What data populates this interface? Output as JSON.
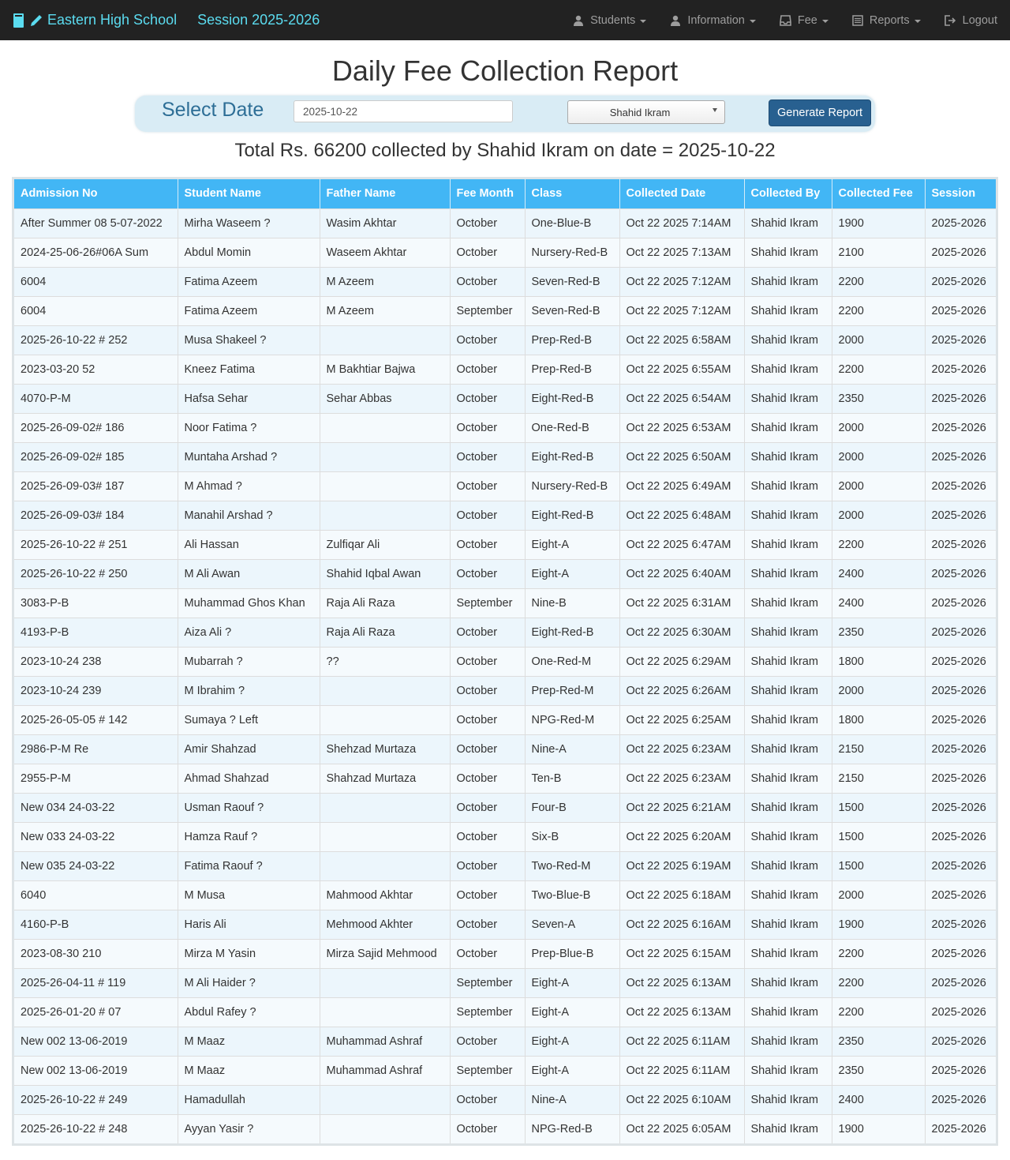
{
  "navbar": {
    "school_name": "Eastern High School",
    "session_label": "Session 2025-2026",
    "menu": [
      {
        "label": "Students",
        "icon": "user-icon",
        "dropdown": true
      },
      {
        "label": "Information",
        "icon": "user-icon",
        "dropdown": true
      },
      {
        "label": "Fee",
        "icon": "inbox-icon",
        "dropdown": true
      },
      {
        "label": "Reports",
        "icon": "list-alt-icon",
        "dropdown": true
      },
      {
        "label": "Logout",
        "icon": "logout-icon",
        "dropdown": false
      }
    ]
  },
  "page_title": "Daily Fee Collection Report",
  "filter": {
    "label": "Select Date",
    "date_value": "2025-10-22",
    "collector_selected": "Shahid Ikram",
    "generate_label": "Generate Report"
  },
  "total_text": "Total Rs. 66200 collected by Shahid Ikram on date = 2025-10-22",
  "colors": {
    "navbar_bg": "#222222",
    "brand": "#5bdcf0",
    "table_header": "#42b6f5",
    "button": "#286090"
  },
  "table": {
    "columns": [
      "Admission No",
      "Student Name",
      "Father Name",
      "Fee Month",
      "Class",
      "Collected Date",
      "Collected By",
      "Collected Fee",
      "Session"
    ],
    "rows": [
      [
        "After Summer 08 5-07-2022",
        "Mirha Waseem ?",
        "Wasim Akhtar",
        "October",
        "One-Blue-B",
        "Oct 22 2025 7:14AM",
        "Shahid Ikram",
        "1900",
        "2025-2026"
      ],
      [
        "2024-25-06-26#06A Sum",
        "Abdul Momin",
        "Waseem Akhtar",
        "October",
        "Nursery-Red-B",
        "Oct 22 2025 7:13AM",
        "Shahid Ikram",
        "2100",
        "2025-2026"
      ],
      [
        "6004",
        "Fatima Azeem",
        "M Azeem",
        "October",
        "Seven-Red-B",
        "Oct 22 2025 7:12AM",
        "Shahid Ikram",
        "2200",
        "2025-2026"
      ],
      [
        "6004",
        "Fatima Azeem",
        "M Azeem",
        "September",
        "Seven-Red-B",
        "Oct 22 2025 7:12AM",
        "Shahid Ikram",
        "2200",
        "2025-2026"
      ],
      [
        "2025-26-10-22 # 252",
        "Musa Shakeel ?",
        "",
        "October",
        "Prep-Red-B",
        "Oct 22 2025 6:58AM",
        "Shahid Ikram",
        "2000",
        "2025-2026"
      ],
      [
        "2023-03-20 52",
        "Kneez Fatima",
        "M Bakhtiar Bajwa",
        "October",
        "Prep-Red-B",
        "Oct 22 2025 6:55AM",
        "Shahid Ikram",
        "2200",
        "2025-2026"
      ],
      [
        "4070-P-M",
        "Hafsa Sehar",
        "Sehar Abbas",
        "October",
        "Eight-Red-B",
        "Oct 22 2025 6:54AM",
        "Shahid Ikram",
        "2350",
        "2025-2026"
      ],
      [
        "2025-26-09-02# 186",
        "Noor Fatima ?",
        "",
        "October",
        "One-Red-B",
        "Oct 22 2025 6:53AM",
        "Shahid Ikram",
        "2000",
        "2025-2026"
      ],
      [
        "2025-26-09-02# 185",
        "Muntaha Arshad ?",
        "",
        "October",
        "Eight-Red-B",
        "Oct 22 2025 6:50AM",
        "Shahid Ikram",
        "2000",
        "2025-2026"
      ],
      [
        "2025-26-09-03# 187",
        "M Ahmad ?",
        "",
        "October",
        "Nursery-Red-B",
        "Oct 22 2025 6:49AM",
        "Shahid Ikram",
        "2000",
        "2025-2026"
      ],
      [
        "2025-26-09-03# 184",
        "Manahil Arshad ?",
        "",
        "October",
        "Eight-Red-B",
        "Oct 22 2025 6:48AM",
        "Shahid Ikram",
        "2000",
        "2025-2026"
      ],
      [
        "2025-26-10-22 # 251",
        "Ali Hassan",
        "Zulfiqar Ali",
        "October",
        "Eight-A",
        "Oct 22 2025 6:47AM",
        "Shahid Ikram",
        "2200",
        "2025-2026"
      ],
      [
        "2025-26-10-22 # 250",
        "M Ali Awan",
        "Shahid Iqbal Awan",
        "October",
        "Eight-A",
        "Oct 22 2025 6:40AM",
        "Shahid Ikram",
        "2400",
        "2025-2026"
      ],
      [
        "3083-P-B",
        "Muhammad Ghos Khan",
        "Raja Ali Raza",
        "September",
        "Nine-B",
        "Oct 22 2025 6:31AM",
        "Shahid Ikram",
        "2400",
        "2025-2026"
      ],
      [
        "4193-P-B",
        "Aiza Ali ?",
        "Raja Ali Raza",
        "October",
        "Eight-Red-B",
        "Oct 22 2025 6:30AM",
        "Shahid Ikram",
        "2350",
        "2025-2026"
      ],
      [
        "2023-10-24 238",
        "Mubarrah ?",
        "??",
        "October",
        "One-Red-M",
        "Oct 22 2025 6:29AM",
        "Shahid Ikram",
        "1800",
        "2025-2026"
      ],
      [
        "2023-10-24 239",
        "M Ibrahim ?",
        "",
        "October",
        "Prep-Red-M",
        "Oct 22 2025 6:26AM",
        "Shahid Ikram",
        "2000",
        "2025-2026"
      ],
      [
        "2025-26-05-05 # 142",
        "Sumaya ? Left",
        "",
        "October",
        "NPG-Red-M",
        "Oct 22 2025 6:25AM",
        "Shahid Ikram",
        "1800",
        "2025-2026"
      ],
      [
        "2986-P-M Re",
        "Amir Shahzad",
        "Shehzad Murtaza",
        "October",
        "Nine-A",
        "Oct 22 2025 6:23AM",
        "Shahid Ikram",
        "2150",
        "2025-2026"
      ],
      [
        "2955-P-M",
        "Ahmad Shahzad",
        "Shahzad Murtaza",
        "October",
        "Ten-B",
        "Oct 22 2025 6:23AM",
        "Shahid Ikram",
        "2150",
        "2025-2026"
      ],
      [
        "New 034 24-03-22",
        "Usman Raouf ?",
        "",
        "October",
        "Four-B",
        "Oct 22 2025 6:21AM",
        "Shahid Ikram",
        "1500",
        "2025-2026"
      ],
      [
        "New 033 24-03-22",
        "Hamza Rauf ?",
        "",
        "October",
        "Six-B",
        "Oct 22 2025 6:20AM",
        "Shahid Ikram",
        "1500",
        "2025-2026"
      ],
      [
        "New 035 24-03-22",
        "Fatima Raouf ?",
        "",
        "October",
        "Two-Red-M",
        "Oct 22 2025 6:19AM",
        "Shahid Ikram",
        "1500",
        "2025-2026"
      ],
      [
        "6040",
        "M Musa",
        "Mahmood Akhtar",
        "October",
        "Two-Blue-B",
        "Oct 22 2025 6:18AM",
        "Shahid Ikram",
        "2000",
        "2025-2026"
      ],
      [
        "4160-P-B",
        "Haris Ali",
        "Mehmood Akhter",
        "October",
        "Seven-A",
        "Oct 22 2025 6:16AM",
        "Shahid Ikram",
        "1900",
        "2025-2026"
      ],
      [
        "2023-08-30 210",
        "Mirza M Yasin",
        "Mirza Sajid Mehmood",
        "October",
        "Prep-Blue-B",
        "Oct 22 2025 6:15AM",
        "Shahid Ikram",
        "2200",
        "2025-2026"
      ],
      [
        "2025-26-04-11 # 119",
        "M Ali Haider ?",
        "",
        "September",
        "Eight-A",
        "Oct 22 2025 6:13AM",
        "Shahid Ikram",
        "2200",
        "2025-2026"
      ],
      [
        "2025-26-01-20 # 07",
        "Abdul Rafey ?",
        "",
        "September",
        "Eight-A",
        "Oct 22 2025 6:13AM",
        "Shahid Ikram",
        "2200",
        "2025-2026"
      ],
      [
        "New 002 13-06-2019",
        "M Maaz",
        "Muhammad Ashraf",
        "October",
        "Eight-A",
        "Oct 22 2025 6:11AM",
        "Shahid Ikram",
        "2350",
        "2025-2026"
      ],
      [
        "New 002 13-06-2019",
        "M Maaz",
        "Muhammad Ashraf",
        "September",
        "Eight-A",
        "Oct 22 2025 6:11AM",
        "Shahid Ikram",
        "2350",
        "2025-2026"
      ],
      [
        "2025-26-10-22 # 249",
        "Hamadullah",
        "",
        "October",
        "Nine-A",
        "Oct 22 2025 6:10AM",
        "Shahid Ikram",
        "2400",
        "2025-2026"
      ],
      [
        "2025-26-10-22 # 248",
        "Ayyan Yasir ?",
        "",
        "October",
        "NPG-Red-B",
        "Oct 22 2025 6:05AM",
        "Shahid Ikram",
        "1900",
        "2025-2026"
      ]
    ]
  }
}
